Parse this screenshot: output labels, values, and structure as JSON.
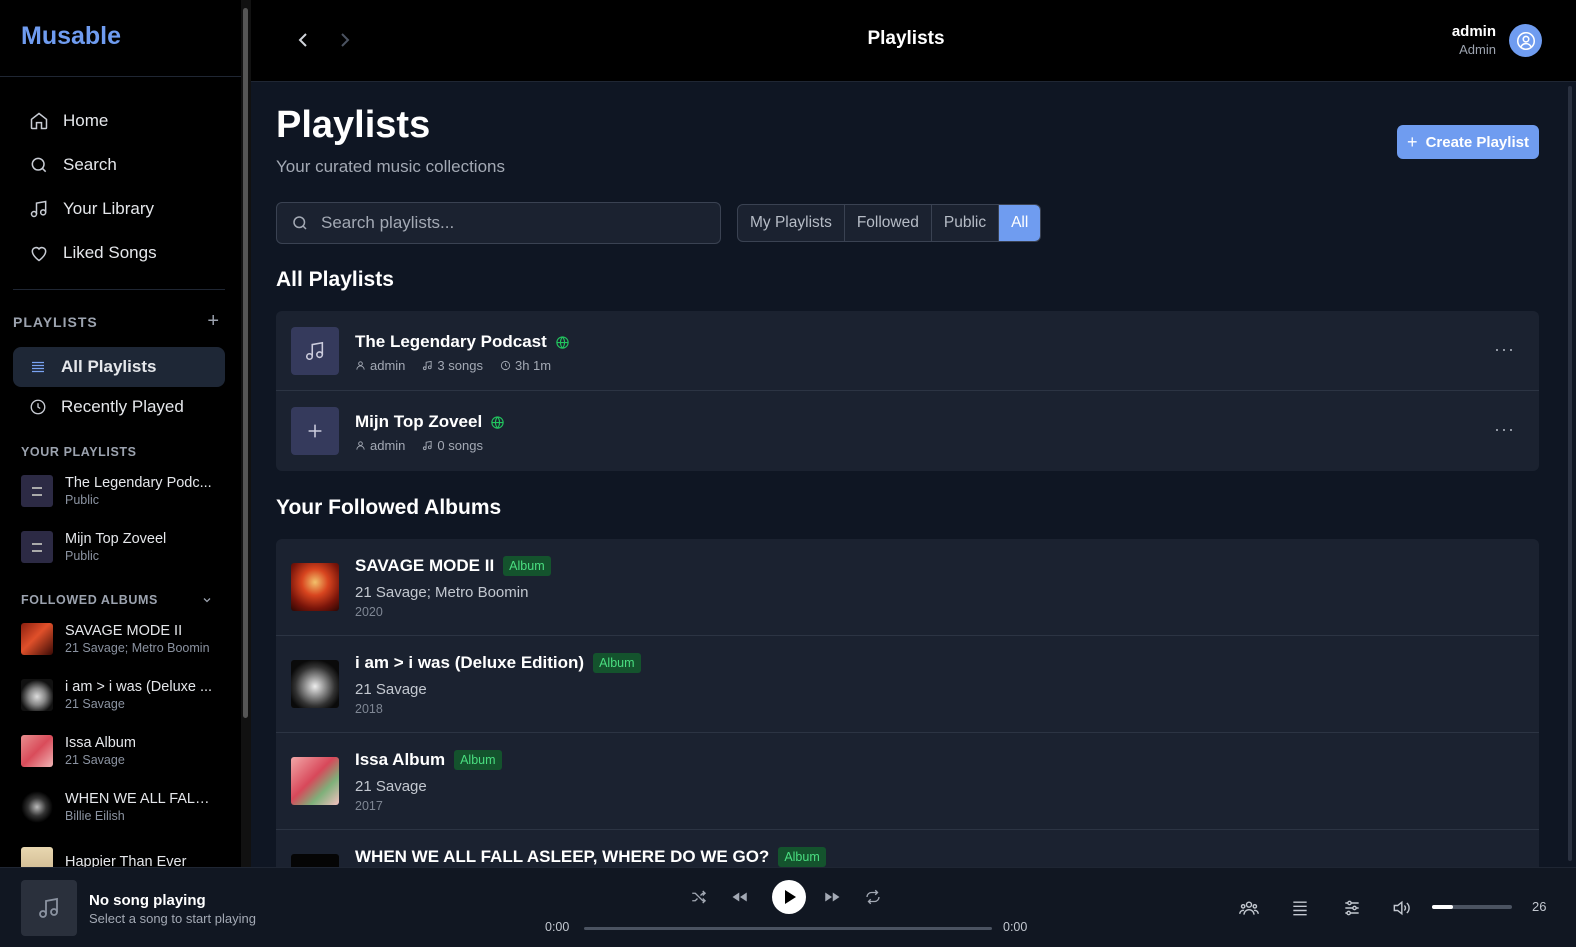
{
  "app": {
    "name": "Musable"
  },
  "nav": {
    "items": [
      {
        "label": "Home",
        "icon": "home-icon"
      },
      {
        "label": "Search",
        "icon": "search-icon"
      },
      {
        "label": "Your Library",
        "icon": "music-note-icon"
      },
      {
        "label": "Liked Songs",
        "icon": "heart-icon"
      }
    ]
  },
  "sidebar": {
    "playlists_heading": "PLAYLISTS",
    "playlist_nav": [
      {
        "label": "All Playlists",
        "active": true
      },
      {
        "label": "Recently Played",
        "active": false
      }
    ],
    "your_playlists_heading": "YOUR PLAYLISTS",
    "your_playlists": [
      {
        "title": "The Legendary Podc...",
        "sub": "Public"
      },
      {
        "title": "Mijn Top Zoveel",
        "sub": "Public"
      }
    ],
    "followed_albums_heading": "FOLLOWED ALBUMS",
    "followed_albums": [
      {
        "title": "SAVAGE MODE II",
        "sub": "21 Savage; Metro Boomin"
      },
      {
        "title": "i am > i was (Deluxe ...",
        "sub": "21 Savage"
      },
      {
        "title": "Issa Album",
        "sub": "21 Savage"
      },
      {
        "title": "WHEN WE ALL FALL ...",
        "sub": "Billie Eilish"
      },
      {
        "title": "Happier Than Ever",
        "sub": ""
      }
    ]
  },
  "topbar": {
    "title": "Playlists",
    "user_name": "admin",
    "user_role": "Admin"
  },
  "page": {
    "title": "Playlists",
    "subtitle": "Your curated music collections",
    "create_label": "Create Playlist",
    "search_placeholder": "Search playlists...",
    "filters": [
      "My Playlists",
      "Followed",
      "Public",
      "All"
    ],
    "active_filter": "All",
    "all_playlists_heading": "All Playlists",
    "playlists": [
      {
        "name": "The Legendary Podcast",
        "owner": "admin",
        "songs": "3 songs",
        "duration": "3h 1m"
      },
      {
        "name": "Mijn Top Zoveel",
        "owner": "admin",
        "songs": "0 songs",
        "duration": ""
      }
    ],
    "albums_heading": "Your Followed Albums",
    "albums": [
      {
        "title": "SAVAGE MODE II",
        "badge": "Album",
        "artist": "21 Savage; Metro Boomin",
        "year": "2020"
      },
      {
        "title": "i am > i was (Deluxe Edition)",
        "badge": "Album",
        "artist": "21 Savage",
        "year": "2018"
      },
      {
        "title": "Issa Album",
        "badge": "Album",
        "artist": "21 Savage",
        "year": "2017"
      },
      {
        "title": "WHEN WE ALL FALL ASLEEP, WHERE DO WE GO?",
        "badge": "Album",
        "artist": "",
        "year": ""
      }
    ]
  },
  "player": {
    "title": "No song playing",
    "subtitle": "Select a song to start playing",
    "current_time": "0:00",
    "total_time": "0:00",
    "volume": "26",
    "volume_level": 0.26
  },
  "colors": {
    "accent": "#6f9cf0",
    "public": "#22c55e",
    "badge_bg": "#14532d",
    "badge_fg": "#4ade80"
  }
}
